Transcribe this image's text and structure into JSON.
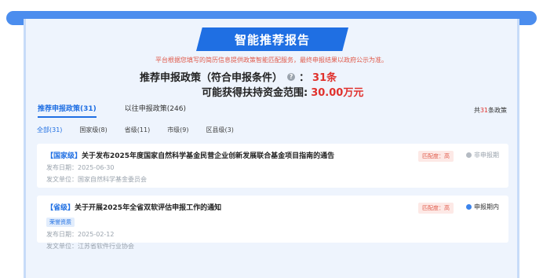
{
  "header": {
    "title": "智能推荐报告",
    "notice": "平台根据您填写的简历信息提供政策智能匹配服务，最终申报结果以政府公示为准。",
    "recommend_label": "推荐申报政策（符合申报条件）",
    "recommend_colon": "：",
    "recommend_count": "31条",
    "fund_label": "可能获得扶持资金范围:",
    "fund_value": "30.00万元",
    "help_icon": "?"
  },
  "tabs": [
    {
      "label": "推荐申报政策(31)",
      "active": true
    },
    {
      "label": "以往申报政策(246)",
      "active": false
    }
  ],
  "total": {
    "prefix": "共",
    "count": "31",
    "suffix": "条政策"
  },
  "filters": [
    {
      "label": "全部(31)",
      "active": true
    },
    {
      "label": "国家级(8)",
      "active": false
    },
    {
      "label": "省级(11)",
      "active": false
    },
    {
      "label": "市级(9)",
      "active": false
    },
    {
      "label": "区县级(3)",
      "active": false
    }
  ],
  "items": [
    {
      "level": "【国家级】",
      "title": "关于发布2025年度国家自然科学基金民营企业创新发展联合基金项目指南的通告",
      "tag": "",
      "date": "发布日期：2025-06-30",
      "unit": "发文单位：国家自然科学基金委员会",
      "match": "匹配度：高",
      "status": "非申报期"
    },
    {
      "level": "【省级】",
      "title": "关于开展2025年全省双软评估申报工作的通知",
      "tag": "荣誉资质",
      "date": "发布日期：2025-02-12",
      "unit": "发文单位：江苏省软件行业协会",
      "match": "匹配度：高",
      "status": "申报期内"
    }
  ],
  "colors": {
    "accent": "#1f6fe3",
    "highlight": "#e0312d",
    "background": "#eef4fd"
  }
}
